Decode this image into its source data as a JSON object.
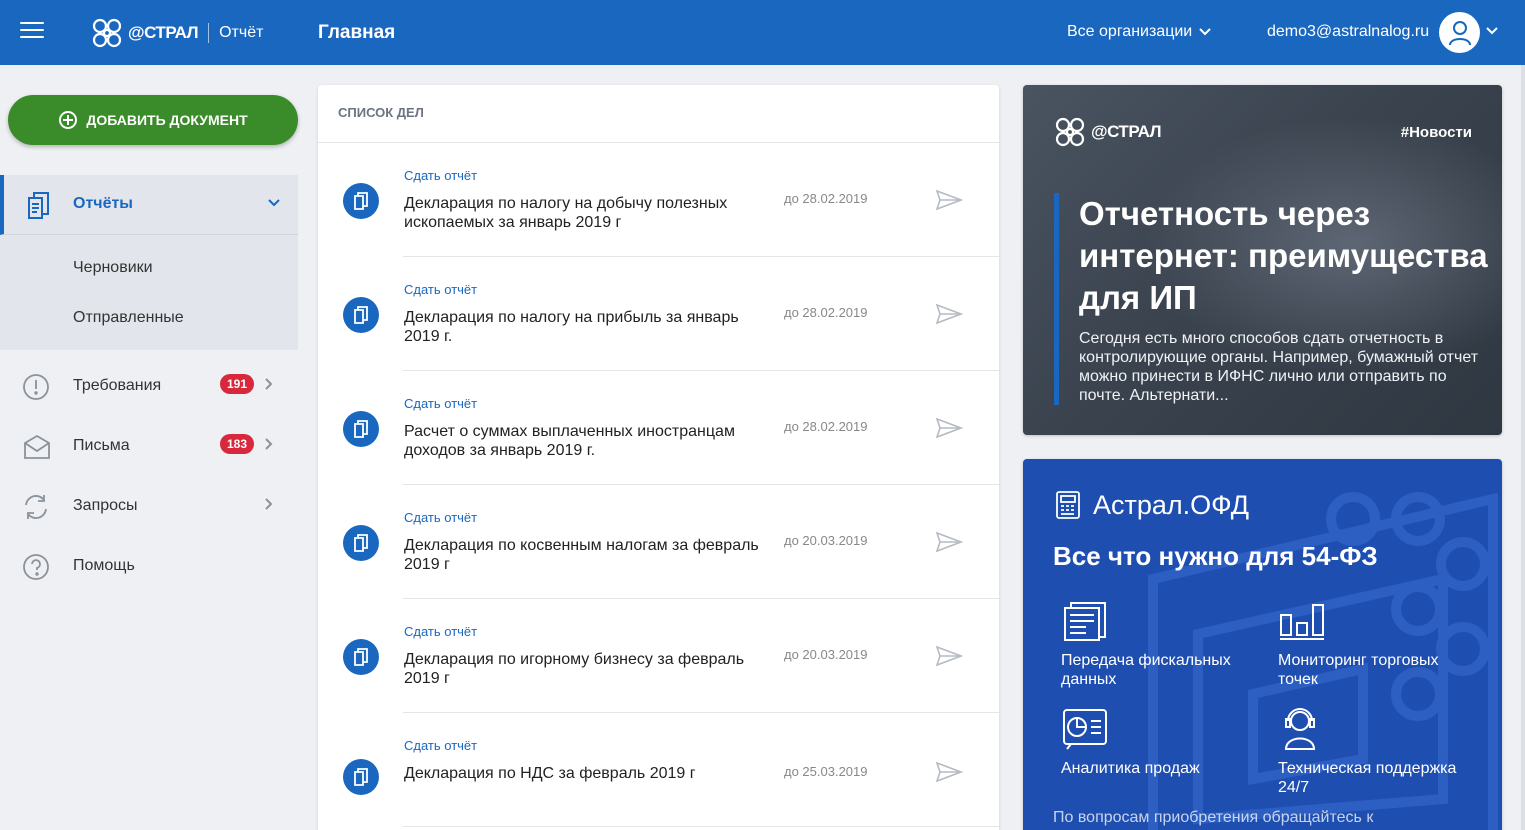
{
  "header": {
    "logo_text": "@СТРАЛ",
    "product": "Отчёт",
    "page_title": "Главная",
    "org_select": "Все организации",
    "user_email": "demo3@astralnalog.ru"
  },
  "sidebar": {
    "add_button": "ДОБАВИТЬ ДОКУМЕНТ",
    "reports": {
      "label": "Отчёты",
      "sub": [
        "Черновики",
        "Отправленные"
      ]
    },
    "items": [
      {
        "label": "Требования",
        "badge": "191"
      },
      {
        "label": "Письма",
        "badge": "183"
      },
      {
        "label": "Запросы"
      },
      {
        "label": "Помощь"
      }
    ]
  },
  "tasks": {
    "title": "СПИСОК ДЕЛ",
    "items": [
      {
        "type": "Сдать отчёт",
        "name": "Декларация по налогу на добычу полезных ископаемых за январь 2019 г",
        "due": "до 28.02.2019"
      },
      {
        "type": "Сдать отчёт",
        "name": "Декларация по налогу на прибыль за январь 2019 г.",
        "due": "до 28.02.2019"
      },
      {
        "type": "Сдать отчёт",
        "name": "Расчет о суммах выплаченных иностранцам доходов за январь 2019 г.",
        "due": "до 28.02.2019"
      },
      {
        "type": "Сдать отчёт",
        "name": "Декларация по косвенным налогам за февраль 2019 г",
        "due": "до 20.03.2019"
      },
      {
        "type": "Сдать отчёт",
        "name": "Декларация по игорному бизнесу за февраль 2019 г",
        "due": "до 20.03.2019"
      },
      {
        "type": "Сдать отчёт",
        "name": "Декларация по НДС за февраль 2019 г",
        "due": "до 25.03.2019"
      }
    ]
  },
  "news": {
    "logo_text": "@СТРАЛ",
    "tag": "#Новости",
    "title": "Отчетность через интернет: преимущества для ИП",
    "text": "Сегодня есть много способов сдать отчетность в контролирующие органы. Например, бумажный отчет можно принести в ИФНС лично или отправить по почте. Альтернати..."
  },
  "ofd": {
    "brand": "Астрал.ОФД",
    "headline": "Все что нужно для 54-ФЗ",
    "features": [
      "Передача фискальных данных",
      "Мониторинг торговых точек",
      "Аналитика продаж",
      "Техническая поддержка 24/7"
    ],
    "footer": "По вопросам приобретения обращайтесь к"
  },
  "colors": {
    "primary": "#1a67c0",
    "add_button": "#3a8b2a",
    "badge": "#d8283c"
  }
}
